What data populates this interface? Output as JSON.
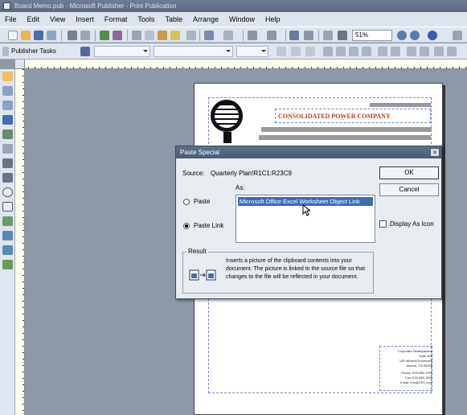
{
  "window": {
    "title": "Board Memo.pub - Microsoft Publisher - Print Publication"
  },
  "menu": [
    "File",
    "Edit",
    "View",
    "Insert",
    "Format",
    "Tools",
    "Table",
    "Arrange",
    "Window",
    "Help"
  ],
  "toolbar": {
    "zoom": "51%",
    "publisher_tasks": "Publisher Tasks"
  },
  "document": {
    "company": "CONSOLIDATED POWER COMPANY",
    "address_lines": [
      "Corporate Headquarters",
      "Suite 400",
      "135 Winfield Boulevard",
      "Atlanta, GA 30328",
      "Phone: 678-555-7000",
      "Fax: 678-555-7000",
      "Email: info@CPC.com"
    ]
  },
  "dialog": {
    "title": "Paste Special",
    "source_label": "Source:",
    "source_value": "Quarterly Plan!R1C1:R23C9",
    "as_label": "As:",
    "as_options": [
      "Microsoft Office Excel Worksheet Object Link"
    ],
    "paste_label": "Paste",
    "paste_link_label": "Paste Link",
    "selected_mode": "Paste Link",
    "display_as_icon_label": "Display As Icon",
    "ok_label": "OK",
    "cancel_label": "Cancel",
    "result_label": "Result",
    "result_text": "Inserts a picture of the clipboard contents into your document. The picture is linked to the source file so that changes to the file will be reflected in your document."
  }
}
